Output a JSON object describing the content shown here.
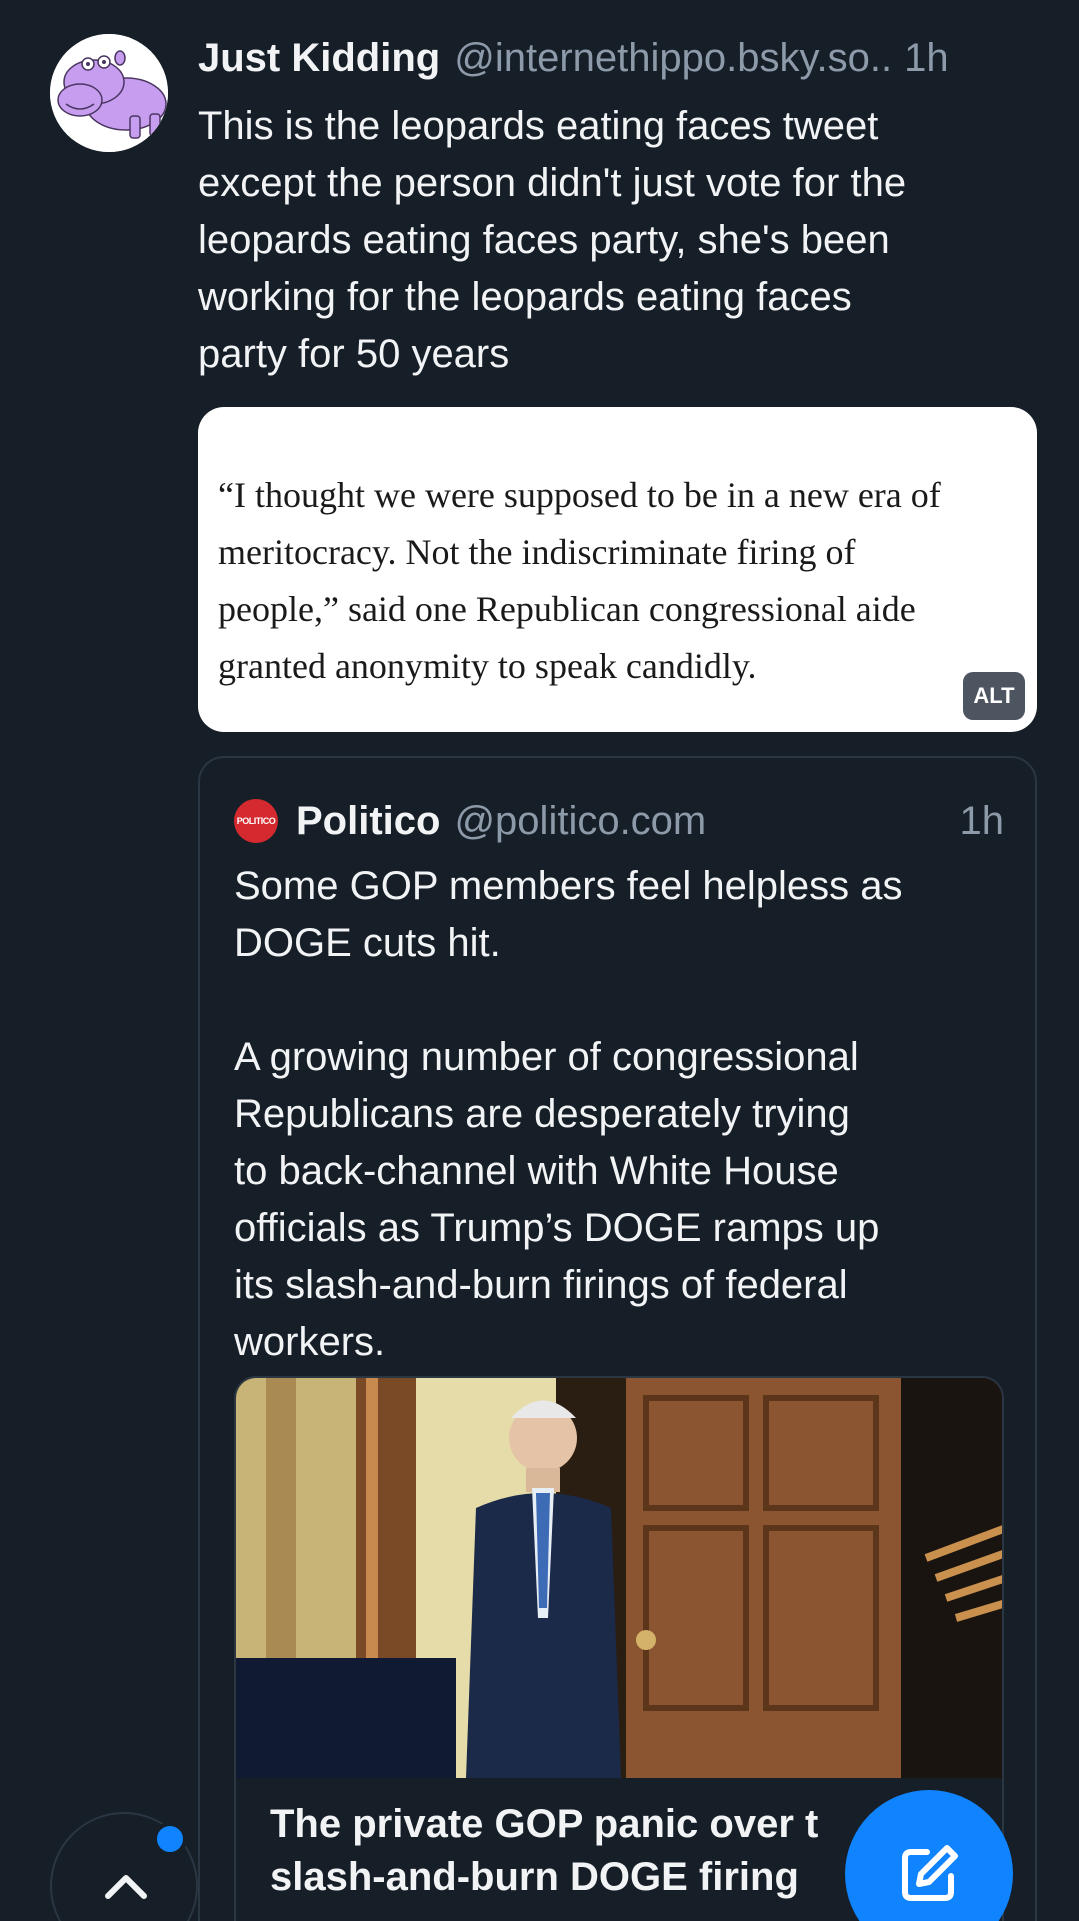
{
  "post": {
    "author_name": "Just Kidding",
    "author_handle": "@internethippo.bsky.so..",
    "time": "1h",
    "text": "This is the leopards eating faces tweet\nexcept the person didn't just vote for the\nleopards eating faces party, she's been\nworking for the leopards eating faces\nparty for 50 years",
    "image_embed": {
      "text": "“I thought we were supposed to be in a new era of\nmeritocracy. Not the indiscriminate firing of\npeople,” said one Republican congressional aide\ngranted anonymity to speak candidly.",
      "alt_label": "ALT"
    }
  },
  "quote": {
    "avatar_label": "POLITICO",
    "author_name": "Politico",
    "author_handle": "@politico.com",
    "time": "1h",
    "text": "Some GOP members feel helpless as\nDOGE cuts hit.\n\nA growing number of congressional\nRepublicans are desperately trying\nto back-channel with White House\nofficials as Trump’s DOGE ramps up\nits slash-and-burn firings of federal\nworkers.",
    "link_title": "The private GOP panic over t\nslash-and-burn DOGE firing"
  },
  "colors": {
    "background": "#161e27",
    "accent": "#1083fe",
    "muted_text": "#8d9aa9",
    "border": "#2b3643",
    "politico_red": "#d42a2f"
  },
  "icons": {
    "scroll_top": "chevron-up-icon",
    "compose": "compose-pencil-icon",
    "avatar": "hippo-avatar-icon"
  }
}
